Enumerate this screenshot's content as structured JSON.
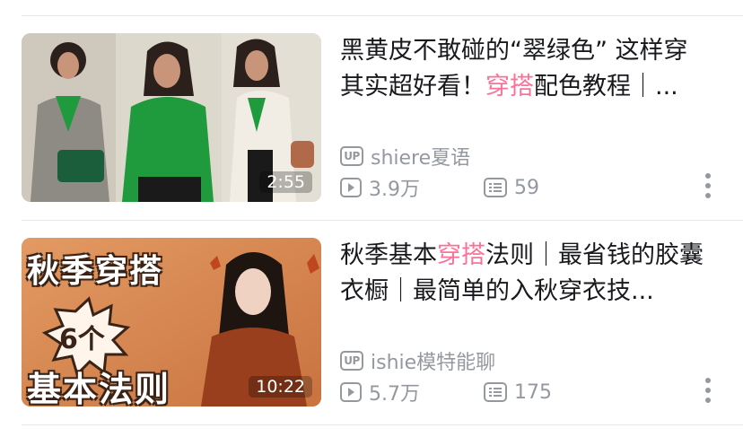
{
  "videos": [
    {
      "title_parts": [
        "黑黄皮不敢碰的“翠绿色” 这样穿其实超好看！",
        "穿搭",
        "配色教程｜..."
      ],
      "duration": "2:55",
      "up_badge": "UP",
      "uploader": "shiere夏语",
      "views": "3.9万",
      "danmaku": "59",
      "thumb": {
        "bg": "#d9d4c8",
        "accent": "#1f9a3c"
      }
    },
    {
      "title_parts": [
        "秋季基本",
        "穿搭",
        "法则｜最省钱的胶囊衣橱｜最简单的入秋穿衣技..."
      ],
      "duration": "10:22",
      "up_badge": "UP",
      "uploader": "ishie模特能聊",
      "views": "5.7万",
      "danmaku": "175",
      "thumb": {
        "bg": "#d98a55",
        "text_top": "秋季穿搭",
        "text_badge": "6个",
        "text_bottom": "基本法则"
      }
    }
  ],
  "colors": {
    "highlight": "#fb7299",
    "meta": "#9499a0",
    "title": "#18191c"
  }
}
